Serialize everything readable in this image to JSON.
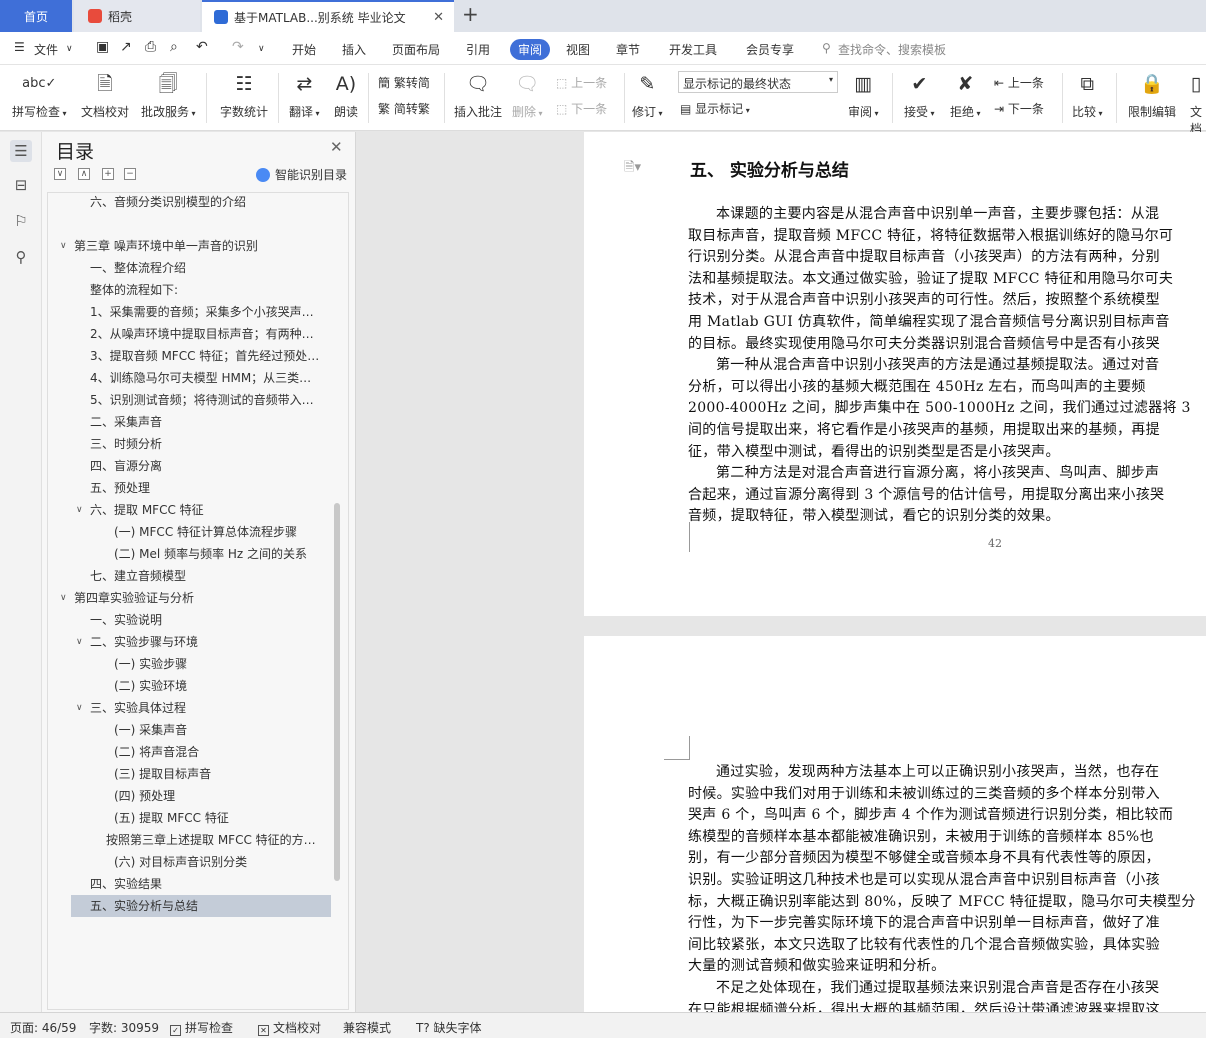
{
  "tabs": {
    "home": "首页",
    "daoke": "稻壳",
    "doc": "基于MATLAB...别系统 毕业论文"
  },
  "menu": {
    "file": "文件",
    "start": "开始",
    "insert": "插入",
    "layout": "页面布局",
    "references": "引用",
    "review": "审阅",
    "view": "视图",
    "chapter": "章节",
    "devtools": "开发工具",
    "member": "会员专享",
    "search": "查找命令、搜索模板"
  },
  "ribbon": {
    "spell": "拼写检查",
    "proof": "文档校对",
    "annotate_service": "批改服务",
    "wordcount": "字数统计",
    "translate": "翻译",
    "read": "朗读",
    "trad": "繁转简",
    "simp": "简转繁",
    "insert_comment": "插入批注",
    "delete": "删除",
    "prev_comment": "上一条",
    "next_comment": "下一条",
    "revise": "修订",
    "markup_state": "显示标记的最终状态",
    "show_markup": "显示标记",
    "review_pane": "审阅",
    "accept": "接受",
    "reject": "拒绝",
    "prev": "上一条",
    "next": "下一条",
    "compare": "比较",
    "restrict": "限制编辑",
    "doc_more": "文档"
  },
  "toc": {
    "title": "目录",
    "smart": "智能识别目录",
    "items": [
      {
        "t": "六、音频分类识别模型的介绍"
      },
      {
        "t": "第三章 噪声环境中单一声音的识别"
      },
      {
        "t": "一、整体流程介绍"
      },
      {
        "t": "整体的流程如下:"
      },
      {
        "t": "1、采集需要的音频；采集多个小孩哭声…"
      },
      {
        "t": "2、从噪声环境中提取目标声音；有两种…"
      },
      {
        "t": "3、提取音频 MFCC 特征；首先经过预处…"
      },
      {
        "t": "4、训练隐马尔可夫模型 HMM；从三类…"
      },
      {
        "t": "5、识别测试音频；将待测试的音频带入…"
      },
      {
        "t": "二、采集声音"
      },
      {
        "t": "三、时频分析"
      },
      {
        "t": "四、盲源分离"
      },
      {
        "t": "五、预处理"
      },
      {
        "t": "六、提取 MFCC 特征"
      },
      {
        "t": "(一) MFCC 特征计算总体流程步骤"
      },
      {
        "t": "(二) Mel 频率与频率 Hz 之间的关系"
      },
      {
        "t": "七、建立音频模型"
      },
      {
        "t": "第四章实验验证与分析"
      },
      {
        "t": "一、实验说明"
      },
      {
        "t": "二、实验步骤与环境"
      },
      {
        "t": "(一) 实验步骤"
      },
      {
        "t": "(二) 实验环境"
      },
      {
        "t": "三、实验具体过程"
      },
      {
        "t": "(一) 采集声音"
      },
      {
        "t": "(二) 将声音混合"
      },
      {
        "t": "(三) 提取目标声音"
      },
      {
        "t": "(四) 预处理"
      },
      {
        "t": "(五) 提取 MFCC 特征"
      },
      {
        "t": "按照第三章上述提取 MFCC 特征的方…"
      },
      {
        "t": "(六) 对目标声音识别分类"
      },
      {
        "t": "四、实验结果"
      },
      {
        "t": "五、实验分析与总结"
      }
    ]
  },
  "doc": {
    "heading": "五、 实验分析与总结",
    "page_number": "42",
    "p1": [
      "本课题的主要内容是从混合声音中识别单一声音，主要步骤包括：从混",
      "取目标声音，提取音频 MFCC 特征，将特征数据带入根据训练好的隐马尔可",
      "行识别分类。从混合声音中提取目标声音（小孩哭声）的方法有两种，分别",
      "法和基频提取法。本文通过做实验，验证了提取 MFCC 特征和用隐马尔可夫",
      "技术，对于从混合声音中识别小孩哭声的可行性。然后，按照整个系统模型",
      "用 Matlab GUI 仿真软件，简单编程实现了混合音频信号分离识别目标声音",
      "的目标。最终实现使用隐马尔可夫分类器识别混合音频信号中是否有小孩哭",
      "第一种从混合声音中识别小孩哭声的方法是通过基频提取法。通过对音",
      "分析，可以得出小孩的基频大概范围在 450Hz 左右，而鸟叫声的主要频",
      "2000-4000Hz 之间，脚步声集中在 500-1000Hz 之间，我们通过过滤器将 3",
      "间的信号提取出来，将它看作是小孩哭声的基频，用提取出来的基频，再提",
      "征，带入模型中测试，看得出的识别类型是否是小孩哭声。",
      "第二种方法是对混合声音进行盲源分离，将小孩哭声、鸟叫声、脚步声",
      "合起来，通过盲源分离得到 3 个源信号的估计信号，用提取分离出来小孩哭",
      "音频，提取特征，带入模型测试，看它的识别分类的效果。"
    ],
    "p2": [
      "通过实验，发现两种方法基本上可以正确识别小孩哭声，当然，也存在",
      "时候。实验中我们对用于训练和未被训练过的三类音频的多个样本分别带入",
      "哭声 6 个，鸟叫声 6 个，脚步声 4 个作为测试音频进行识别分类，相比较而",
      "练模型的音频样本基本都能被准确识别，未被用于训练的音频样本 85%也",
      "别，有一少部分音频因为模型不够健全或音频本身不具有代表性等的原因，",
      "识别。实验证明这几种技术也是可以实现从混合声音中识别目标声音（小孩",
      "标，大概正确识别率能达到 80%，反映了 MFCC 特征提取，隐马尔可夫模型分",
      "行性，为下一步完善实际环境下的混合声音中识别单一目标声音，做好了准",
      "间比较紧张，本文只选取了比较有代表性的几个混合音频做实验，具体实验",
      "大量的测试音频和做实验来证明和分析。",
      "不足之处体现在，我们通过提取基频法来识别混合声音是否存在小孩哭",
      "在只能根据频谱分析，得出大概的基频范围，然后设计带通滤波器来提取这"
    ]
  },
  "status": {
    "page": "页面: 46/59",
    "words": "字数: 30959",
    "spell": "拼写检查",
    "proof": "文档校对",
    "compat": "兼容模式",
    "missing_font": "缺失字体"
  }
}
